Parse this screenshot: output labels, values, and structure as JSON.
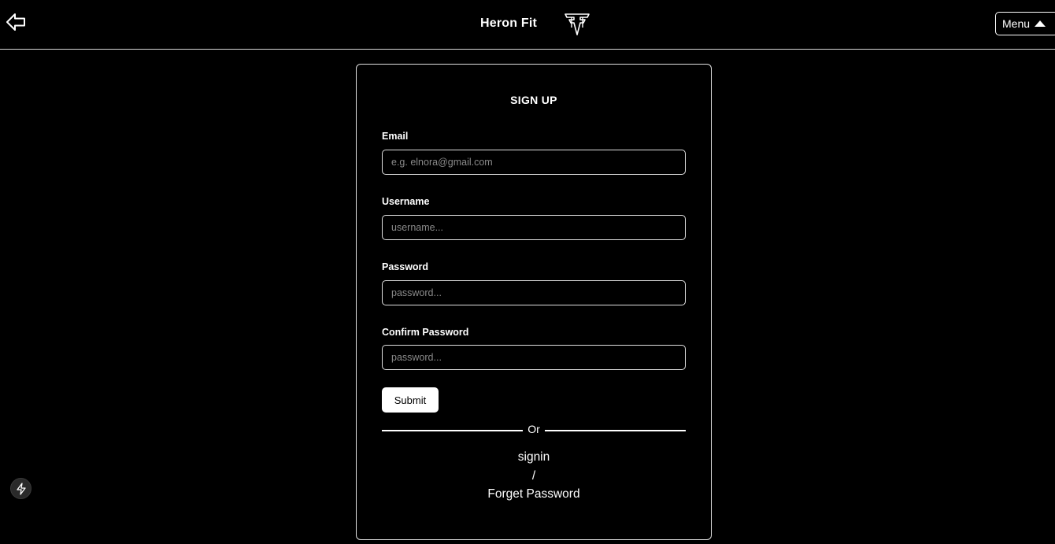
{
  "header": {
    "brand_title": "Heron Fit",
    "menu_label": "Menu",
    "icons": {
      "back": "arrow-left-icon",
      "logo": "heron-fit-logo",
      "menu": "caret-up-icon"
    }
  },
  "form": {
    "title": "SIGN UP",
    "fields": [
      {
        "label": "Email",
        "placeholder": "e.g. elnora@gmail.com",
        "value": ""
      },
      {
        "label": "Username",
        "placeholder": "username...",
        "value": ""
      },
      {
        "label": "Password",
        "placeholder": "password...",
        "value": ""
      },
      {
        "label": "Confirm Password",
        "placeholder": "password...",
        "value": ""
      }
    ],
    "submit_label": "Submit",
    "divider_text": "Or",
    "signin_link": "signin",
    "link_separator": "/",
    "forget_link": "Forget Password"
  },
  "floating": {
    "icon": "lightning-icon"
  },
  "colors": {
    "background": "#000000",
    "foreground": "#ffffff",
    "border": "#e0e0e0",
    "placeholder": "#8a8a8a"
  }
}
